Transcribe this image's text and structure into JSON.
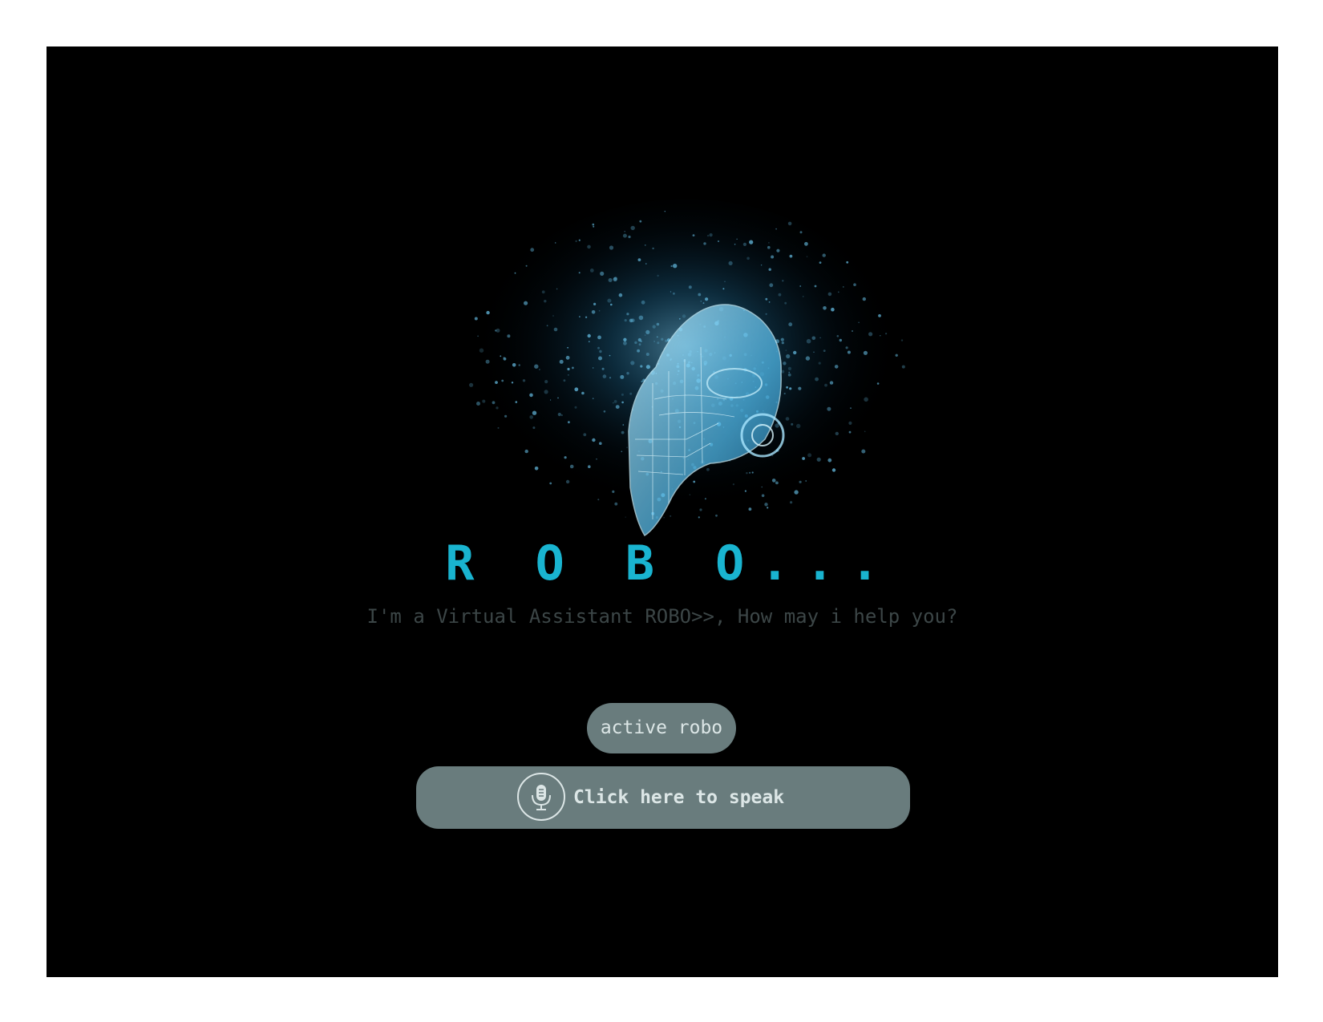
{
  "header": {
    "title": "R O B O...",
    "subtitle": "I'm a Virtual Assistant ROBO>>, How may i help you?"
  },
  "controls": {
    "active_label": "active robo",
    "speak_label": "Click here to speak"
  },
  "icons": {
    "hero": "robot-hologram-image",
    "mic": "microphone-icon"
  },
  "colors": {
    "background": "#000000",
    "accent": "#19b4d0",
    "button": "#697c7d",
    "button_text": "#dce6e6",
    "subtitle": "#3c4647"
  }
}
